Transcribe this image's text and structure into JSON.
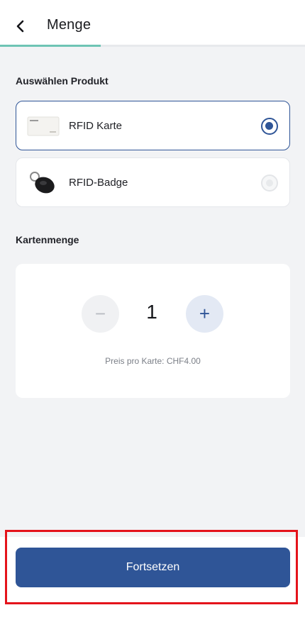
{
  "header": {
    "title": "Menge",
    "progress_percent": 33
  },
  "product_section": {
    "label": "Auswählen Produkt",
    "items": [
      {
        "label": "RFID Karte",
        "selected": true,
        "icon": "rfid-card-thumbnail"
      },
      {
        "label": "RFID-Badge",
        "selected": false,
        "icon": "rfid-badge-thumbnail"
      }
    ]
  },
  "quantity_section": {
    "label": "Kartenmenge",
    "value": "1",
    "minus_symbol": "−",
    "plus_symbol": "+",
    "price_text": "Preis pro Karte: CHF4.00"
  },
  "footer": {
    "continue_label": "Fortsetzen"
  },
  "colors": {
    "primary": "#2f5597",
    "progress": "#6ec4b4",
    "highlight": "#e4131b",
    "background": "#f2f3f5"
  }
}
